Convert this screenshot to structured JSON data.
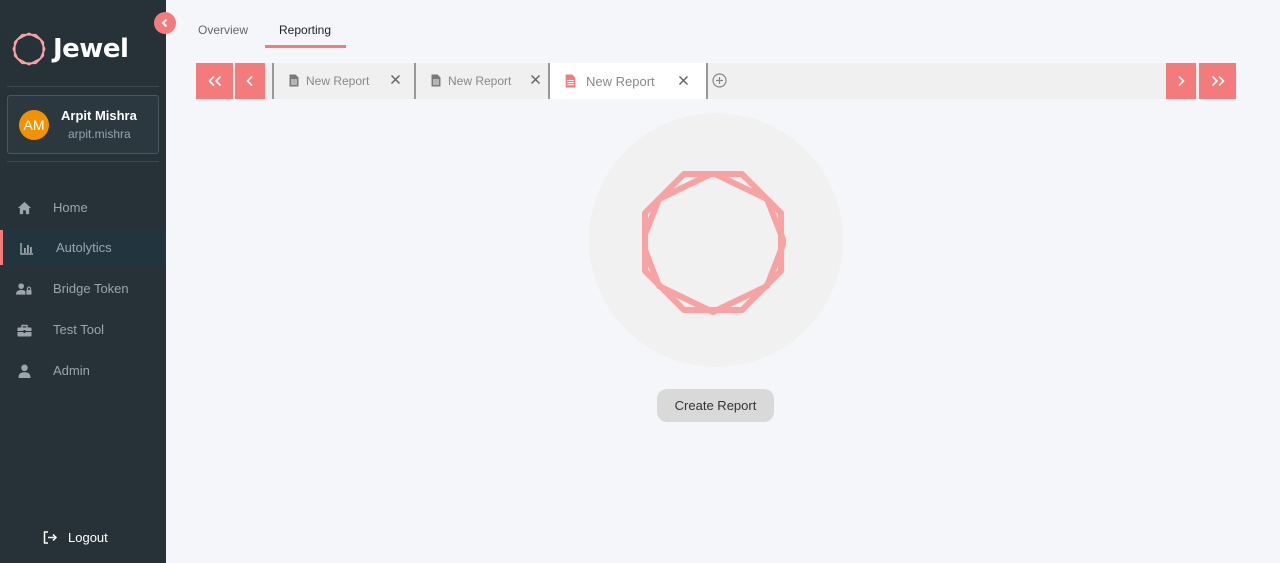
{
  "app": {
    "name": "Jewel"
  },
  "user": {
    "initials": "AM",
    "name": "Arpit Mishra",
    "handle": "arpit.mishra"
  },
  "sidebar": {
    "items": [
      {
        "label": "Home",
        "icon": "home-icon"
      },
      {
        "label": "Autolytics",
        "icon": "bar-chart-icon",
        "active": true
      },
      {
        "label": "Bridge Token",
        "icon": "user-lock-icon"
      },
      {
        "label": "Test Tool",
        "icon": "toolbox-icon"
      },
      {
        "label": "Admin",
        "icon": "user-icon"
      }
    ],
    "logout_label": "Logout"
  },
  "top_tabs": [
    {
      "label": "Overview"
    },
    {
      "label": "Reporting",
      "active": true
    }
  ],
  "report_tabs": [
    {
      "label": "New Report"
    },
    {
      "label": "New Report"
    },
    {
      "label": "New Report",
      "active": true
    }
  ],
  "main": {
    "create_button": "Create Report"
  },
  "colors": {
    "accent": "#f47b7b",
    "sidebar": "#263238",
    "avatar": "#f39200",
    "logo_pink": "#f7a3a3"
  }
}
